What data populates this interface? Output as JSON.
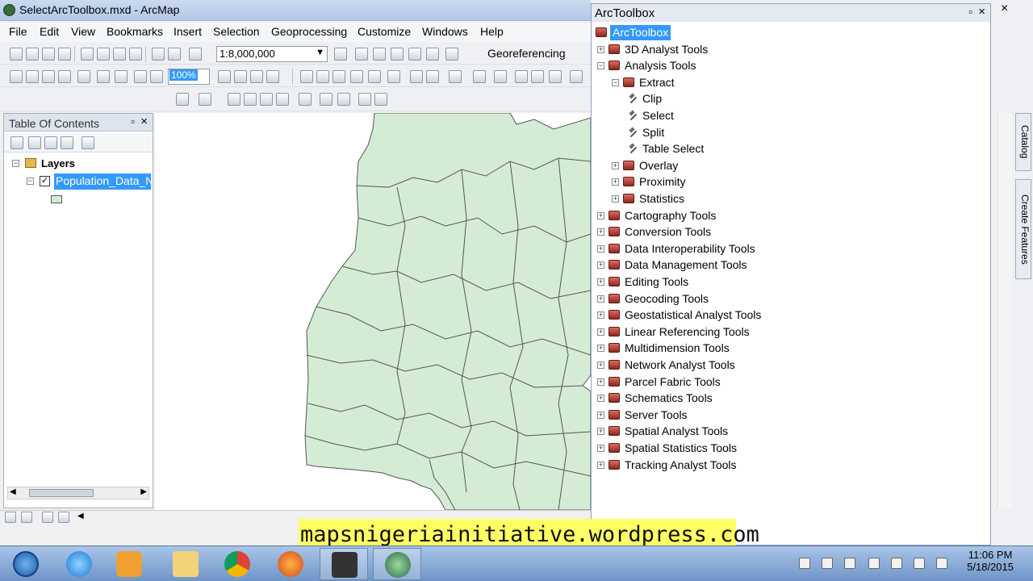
{
  "window": {
    "title": "SelectArcToolbox.mxd - ArcMap"
  },
  "menubar": {
    "items": [
      "File",
      "Edit",
      "View",
      "Bookmarks",
      "Insert",
      "Selection",
      "Geoprocessing",
      "Customize",
      "Windows",
      "Help"
    ]
  },
  "toolbar": {
    "scale": "1:8,000,000",
    "zoom": "100%",
    "georeferencing": "Georeferencing"
  },
  "toc": {
    "title": "Table Of Contents",
    "root": "Layers",
    "layer": "Population_Data_N",
    "layer_checked": true
  },
  "arctoolbox": {
    "title": "ArcToolbox",
    "root": "ArcToolbox",
    "items": [
      "3D Analyst Tools",
      "Analysis Tools",
      "Extract",
      "Clip",
      "Select",
      "Split",
      "Table Select",
      "Overlay",
      "Proximity",
      "Statistics",
      "Cartography Tools",
      "Conversion Tools",
      "Data Interoperability Tools",
      "Data Management Tools",
      "Editing Tools",
      "Geocoding Tools",
      "Geostatistical Analyst Tools",
      "Linear Referencing Tools",
      "Multidimension Tools",
      "Network Analyst Tools",
      "Parcel Fabric Tools",
      "Schematics Tools",
      "Server Tools",
      "Spatial Analyst Tools",
      "Spatial Statistics Tools",
      "Tracking Analyst Tools"
    ]
  },
  "side_tabs": {
    "catalog": "Catalog",
    "create_features": "Create Features"
  },
  "watermark": "mapsnigeriainitiative.wordpress.com",
  "taskbar": {
    "time": "11:06 PM",
    "date": "5/18/2015"
  },
  "colors": {
    "map_fill": "#d4ecd4",
    "selection": "#3399ff",
    "watermark_bg": "#ffff66",
    "toolbox_icon": "#b0362c"
  }
}
